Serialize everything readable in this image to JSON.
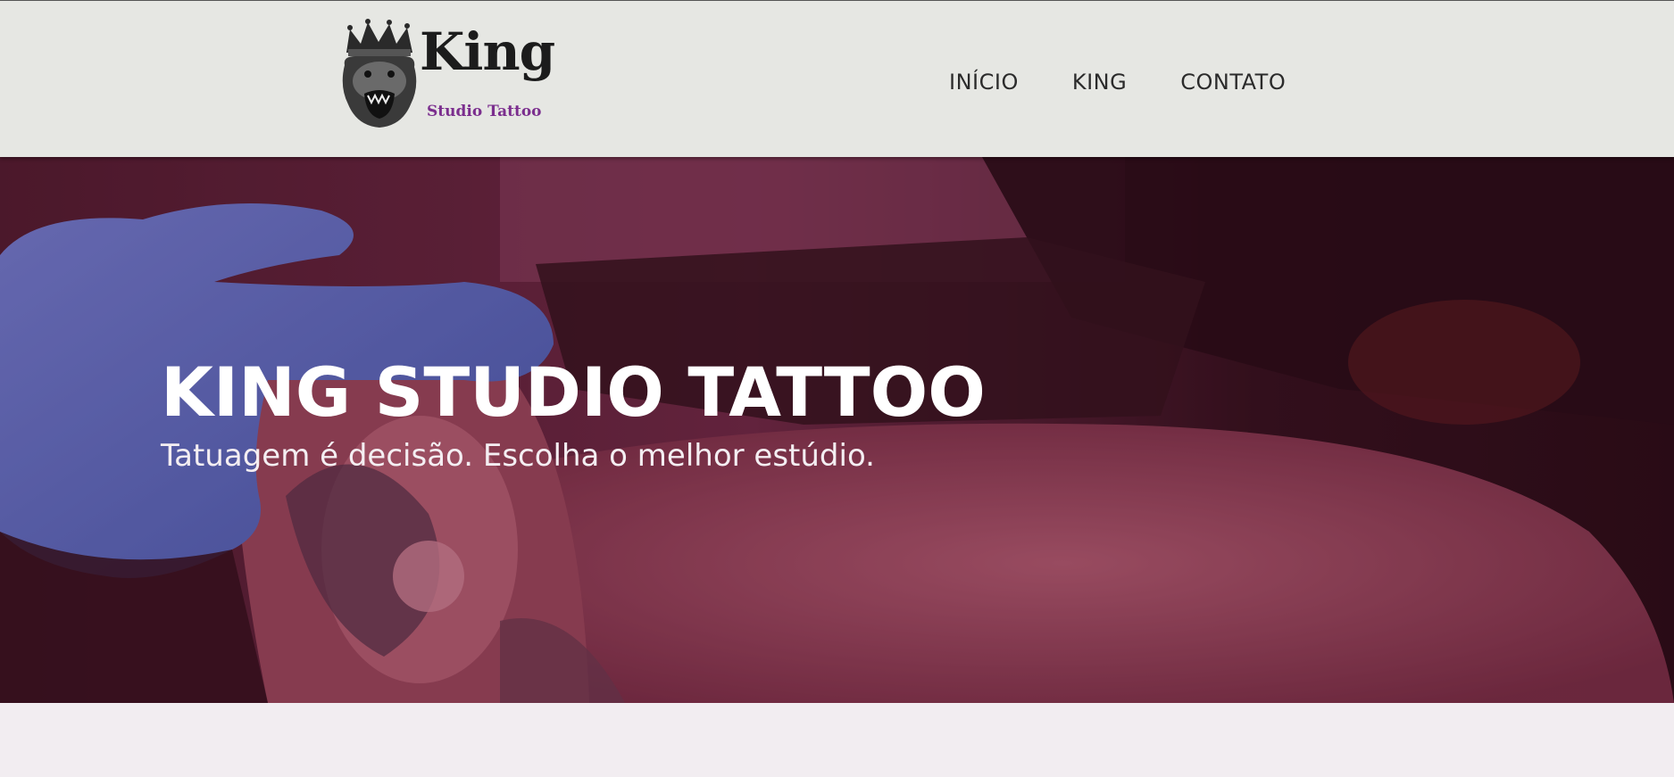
{
  "header": {
    "logo": {
      "name": "King",
      "tagline": "Studio Tattoo",
      "icon": "gorilla-crown-icon",
      "colors": {
        "name": "#1c1c1c",
        "tagline": "#7b2e8e"
      }
    },
    "nav": [
      {
        "label": "INÍCIO"
      },
      {
        "label": "KING"
      },
      {
        "label": "CONTATO"
      }
    ],
    "background": "#e6e7e3"
  },
  "hero": {
    "title": "KING STUDIO TATTOO",
    "subtitle": "Tatuagem é decisão. Escolha o melhor estúdio.",
    "overlay_color": "#3a1422",
    "glove_color": "#4a6fc8"
  },
  "page_background": "#f2edf1"
}
